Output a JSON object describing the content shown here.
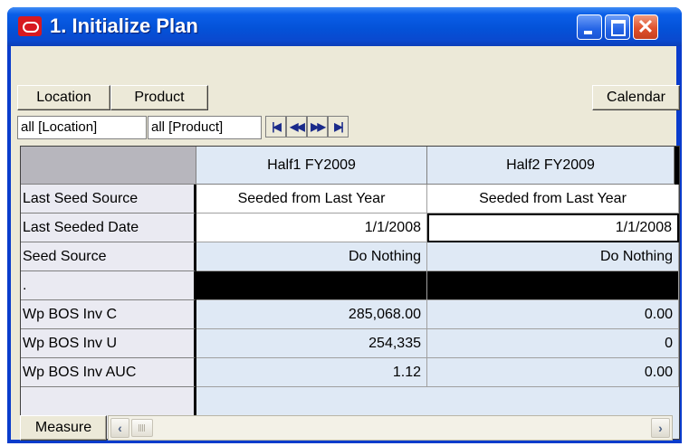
{
  "window": {
    "title": "1. Initialize Plan",
    "icon": "oracle-logo-icon",
    "controls": [
      "minimize-icon",
      "maximize-icon",
      "close-icon"
    ]
  },
  "toolbar": {
    "location_label": "Location",
    "product_label": "Product",
    "calendar_label": "Calendar",
    "location_value": "all [Location]",
    "product_value": "all [Product]",
    "nav": [
      "first-icon",
      "previous-icon",
      "next-icon",
      "last-icon"
    ]
  },
  "grid": {
    "columns": [
      "Half1 FY2009",
      "Half2 FY2009"
    ],
    "rows": [
      {
        "label": "Last Seed Source",
        "values": [
          "Seeded from Last Year",
          "Seeded from Last Year"
        ]
      },
      {
        "label": "Last Seeded Date",
        "values": [
          "1/1/2008",
          "1/1/2008"
        ]
      },
      {
        "label": "Seed Source",
        "values": [
          "Do Nothing",
          "Do Nothing"
        ]
      },
      {
        "label": ".",
        "values": [
          "",
          ""
        ]
      },
      {
        "label": "Wp BOS Inv C",
        "values": [
          "285,068.00",
          "0.00"
        ]
      },
      {
        "label": "Wp BOS Inv U",
        "values": [
          "254,335",
          "0"
        ]
      },
      {
        "label": "Wp BOS Inv AUC",
        "values": [
          "1.12",
          "0.00"
        ]
      }
    ]
  },
  "bottom": {
    "measure_label": "Measure"
  },
  "colors": {
    "titlebar": "#0452d8",
    "cell_blue": "#dfe9f5",
    "window_bg": "#ece9d8"
  }
}
